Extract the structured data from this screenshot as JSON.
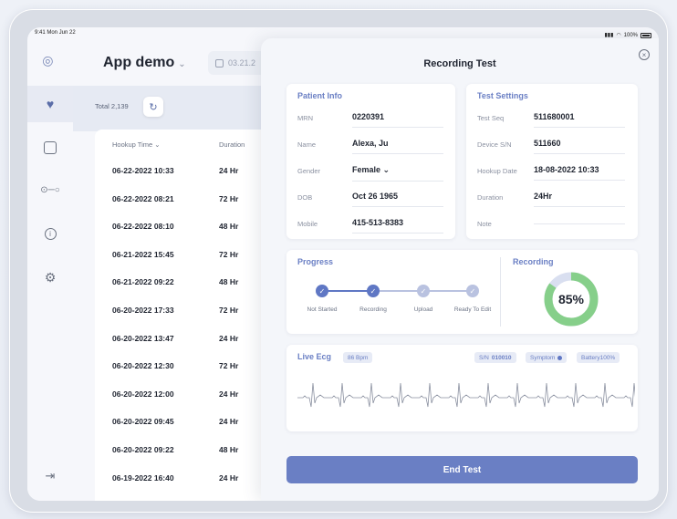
{
  "status": {
    "time_date": "9:41  Mon Jun 22",
    "battery": "100%"
  },
  "header": {
    "app_title": "App demo",
    "date_value": "03.21.2"
  },
  "list": {
    "total": "Total 2,139",
    "columns": [
      "Hookup Time",
      "Duration"
    ],
    "rows": [
      {
        "time": "06-22-2022 10:33",
        "duration": "24 Hr"
      },
      {
        "time": "06-22-2022 08:21",
        "duration": "72 Hr"
      },
      {
        "time": "06-22-2022 08:10",
        "duration": "48 Hr"
      },
      {
        "time": "06-21-2022 15:45",
        "duration": "72 Hr"
      },
      {
        "time": "06-21-2022 09:22",
        "duration": "48 Hr"
      },
      {
        "time": "06-20-2022 17:33",
        "duration": "72 Hr"
      },
      {
        "time": "06-20-2022 13:47",
        "duration": "24 Hr"
      },
      {
        "time": "06-20-2022 12:30",
        "duration": "72 Hr"
      },
      {
        "time": "06-20-2022 12:00",
        "duration": "24 Hr"
      },
      {
        "time": "06-20-2022 09:45",
        "duration": "24 Hr"
      },
      {
        "time": "06-20-2022 09:22",
        "duration": "48 Hr"
      },
      {
        "time": "06-19-2022 16:40",
        "duration": "24 Hr"
      }
    ]
  },
  "dialog": {
    "title": "Recording Test",
    "patient": {
      "title": "Patient Info",
      "fields": [
        {
          "label": "MRN",
          "value": "0220391"
        },
        {
          "label": "Name",
          "value": "Alexa, Ju"
        },
        {
          "label": "Gender",
          "value": "Female ⌄"
        },
        {
          "label": "DOB",
          "value": "Oct 26 1965"
        },
        {
          "label": "Mobile",
          "value": "415-513-8383"
        }
      ]
    },
    "settings": {
      "title": "Test Settings",
      "fields": [
        {
          "label": "Test Seq",
          "value": "511680001"
        },
        {
          "label": "Device S/N",
          "value": "511660"
        },
        {
          "label": "Hookup Date",
          "value": "18-08-2022 10:33"
        },
        {
          "label": "Duration",
          "value": "24Hr"
        },
        {
          "label": "Note",
          "value": ""
        }
      ]
    },
    "progress": {
      "title": "Progress",
      "steps": [
        {
          "label": "Not Started",
          "done": true
        },
        {
          "label": "Recording",
          "done": true
        },
        {
          "label": "Upload",
          "done": false
        },
        {
          "label": "Ready To Edit",
          "done": false
        }
      ]
    },
    "recording": {
      "title": "Recording",
      "percent_label": "85%",
      "fraction": 0.85,
      "colors": {
        "fill": "#86cf8a",
        "track": "#d9dff0"
      }
    },
    "ecg": {
      "title": "Live Ecg",
      "bpm": "86 Bpm",
      "sn_label": "S/N",
      "sn_value": "010010",
      "symptom": "Symptom",
      "battery": "Battery100%"
    },
    "end_button": "End Test"
  },
  "colors": {
    "accent": "#6a7fc4",
    "step_done": "#5f77c4",
    "step_todo": "#b9c2e0"
  }
}
